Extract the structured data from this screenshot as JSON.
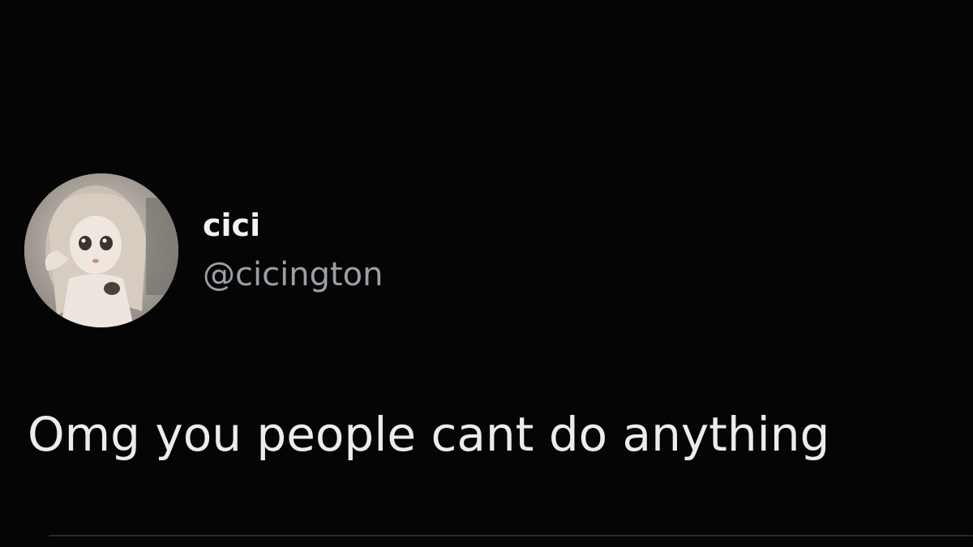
{
  "tweet": {
    "author": {
      "display_name": "cici",
      "handle": "@cicington",
      "avatar_icon": "profile-picture-doll"
    },
    "text": "Omg you people cant do anything"
  },
  "colors": {
    "background": "#050505",
    "primary_text": "#e7e9ea",
    "secondary_text": "#9aa0a6"
  }
}
